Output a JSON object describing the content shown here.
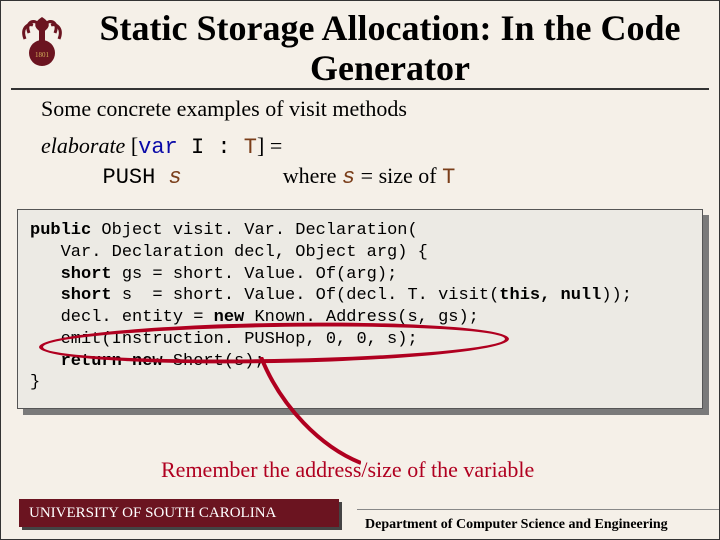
{
  "title": "Static Storage Allocation: In the Code Generator",
  "subtitle": "Some concrete examples of visit methods",
  "elaborate": {
    "label": "elaborate",
    "lb": "[",
    "rb": "]",
    "var": "var",
    "ident": "  I : ",
    "type": "T",
    "eq": " =",
    "push_prefix": "PUSH ",
    "push_arg": "s",
    "where_prefix": "where ",
    "where_var": "s",
    "where_mid": " = size of ",
    "where_type": "T"
  },
  "code": {
    "l1a": "public",
    "l1b": " Object visit. Var. Declaration(",
    "l2": "   Var. Declaration decl, Object arg) {",
    "l3a": "   short",
    "l3b": " gs = short. Value. Of(arg);",
    "l4a": "   short",
    "l4b": " s  = short. Value. Of(decl. T. visit(",
    "l4c": "this, null",
    "l4d": "));",
    "l5a": "   decl. entity = ",
    "l5b": "new",
    "l5c": " Known. Address(s, gs);",
    "l6": "   emit(Instruction. PUSHop, 0, 0, s);",
    "l7a": "   return new",
    "l7b": " Short(s);",
    "l8": "}"
  },
  "remember": "Remember the address/size of the variable",
  "footer": {
    "left": "UNIVERSITY OF SOUTH CAROLINA",
    "right": "Department of Computer Science and Engineering"
  },
  "logo": {
    "name": "usc-seal"
  }
}
